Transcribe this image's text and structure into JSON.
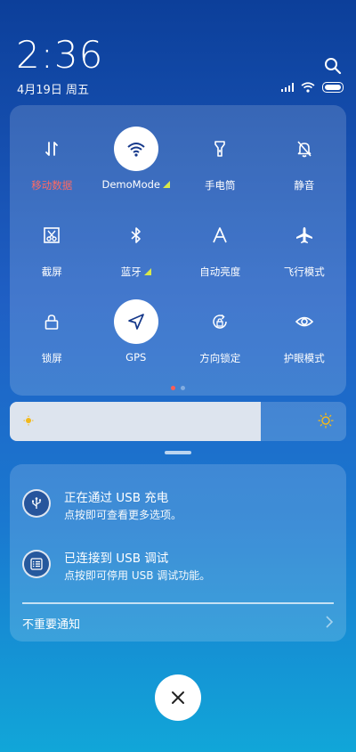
{
  "status": {
    "time": "2:36",
    "date": "4月19日 周五"
  },
  "quick_settings": [
    {
      "label": "移动数据",
      "icon": "mobile-data-icon",
      "on": false,
      "highlight": "#ff6a63"
    },
    {
      "label": "DemoMode",
      "icon": "wifi-icon",
      "on": true
    },
    {
      "label": "手电筒",
      "icon": "flashlight-icon",
      "on": false
    },
    {
      "label": "静音",
      "icon": "mute-bell-icon",
      "on": false
    },
    {
      "label": "截屏",
      "icon": "screenshot-icon",
      "on": false
    },
    {
      "label": "蓝牙",
      "icon": "bluetooth-icon",
      "on": false
    },
    {
      "label": "自动亮度",
      "icon": "auto-brightness-icon",
      "on": false
    },
    {
      "label": "飞行模式",
      "icon": "airplane-icon",
      "on": false
    },
    {
      "label": "锁屏",
      "icon": "lock-icon",
      "on": false
    },
    {
      "label": "GPS",
      "icon": "location-arrow-icon",
      "on": true
    },
    {
      "label": "方向锁定",
      "icon": "rotation-lock-icon",
      "on": false
    },
    {
      "label": "护眼模式",
      "icon": "eye-icon",
      "on": false
    }
  ],
  "page_indicator": {
    "count": 2,
    "active": 0
  },
  "brightness": {
    "level_fraction": 0.745
  },
  "notifications": [
    {
      "title": "正在通过 USB 充电",
      "subtitle": "点按即可查看更多选项。",
      "icon": "usb-icon"
    },
    {
      "title": "已连接到 USB 调试",
      "subtitle": "点按即可停用 USB 调试功能。",
      "icon": "debug-list-icon"
    }
  ],
  "footer": {
    "unimportant_label": "不重要通知"
  },
  "colors": {
    "accent_active_text": "#15388a",
    "mobile_data_red": "#ff6a63",
    "signal_triangle": "#d8e84a"
  }
}
